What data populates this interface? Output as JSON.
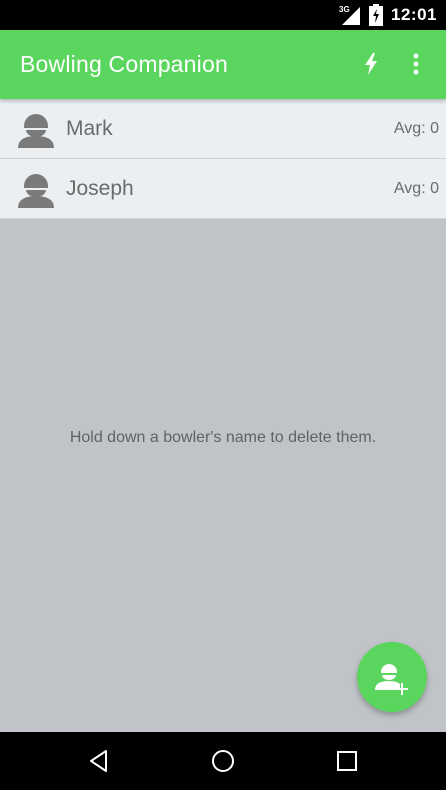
{
  "status_bar": {
    "network": "3G",
    "time": "12:01"
  },
  "app_bar": {
    "title": "Bowling Companion",
    "actions": [
      {
        "icon": "lightning-bolt-icon"
      },
      {
        "icon": "overflow-menu-icon"
      }
    ]
  },
  "bowlers": [
    {
      "name": "Mark",
      "average": "Avg: 0"
    },
    {
      "name": "Joseph",
      "average": "Avg: 0"
    }
  ],
  "hint": "Hold down a bowler's name to delete them.",
  "fab": {
    "icon": "add-bowler-icon"
  },
  "nav_bar": {
    "buttons": [
      "back-icon",
      "home-icon",
      "recents-icon"
    ]
  },
  "colors": {
    "accent": "#5ad55e",
    "list_background": "#ebeff1",
    "content_background": "#c0c4c8",
    "text": "#6b6b6b"
  }
}
